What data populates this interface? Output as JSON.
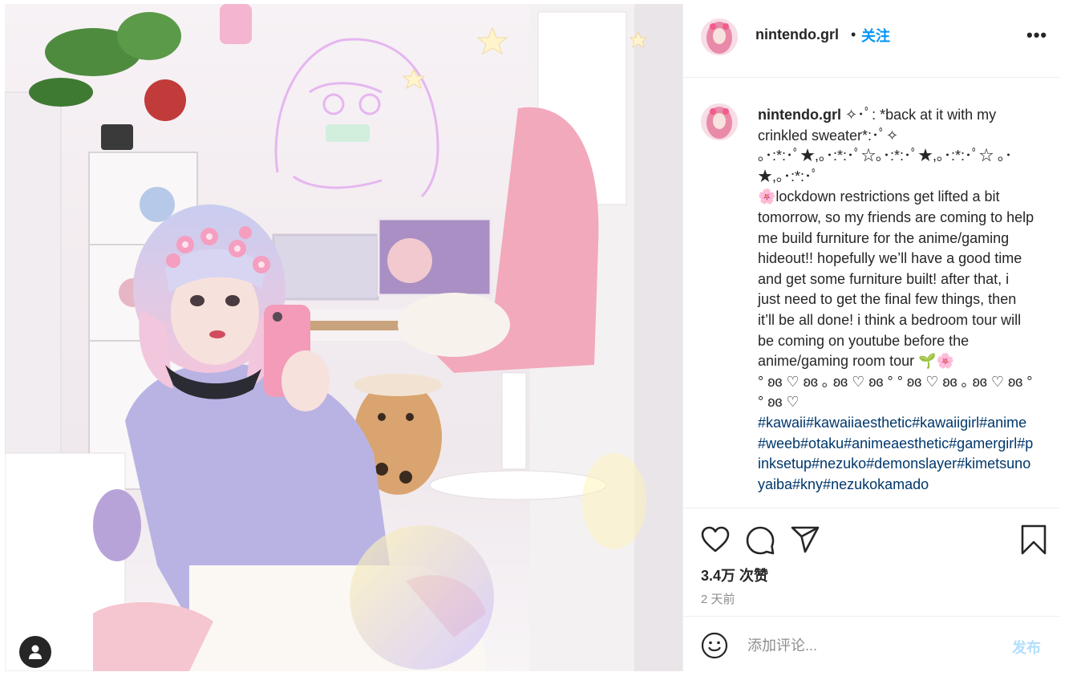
{
  "post": {
    "username": "nintendo.grl",
    "separator": "•",
    "follow_label": "关注",
    "more_icon": "more-horizontal-icon",
    "more_label": "•••"
  },
  "caption": {
    "username": "nintendo.grl",
    "text": " ✧･ﾟ: *back at it with my crinkled sweater*:･ﾟ✧\n｡･:*:･ﾟ★,｡･:*:･ﾟ☆｡･:*:･ﾟ★,｡･:*:･ﾟ☆ ｡･★,｡･:*:･ﾟ\n🌸lockdown restrictions get lifted a bit tomorrow, so my friends are coming to help me build furniture for the anime/gaming hideout!! hopefully we’ll have a good time and get some furniture built! after that, i just need to get the final few things, then it’ll be all done! i think a bedroom tour will be coming on youtube before the anime/gaming room tour 🌱🌸\n° ʚɞ ♡ ʚɞ ｡ ʚɞ ♡ ʚɞ ° ° ʚɞ ♡ ʚɞ ｡ ʚɞ ♡ ʚɞ ° ° ʚɞ ♡\n",
    "hashtags": "#kawaii#kawaiiaesthetic#kawaiigirl#anime#weeb#otaku#animeaesthetic#gamergirl#pinksetup#nezuko#demonslayer#kimetsunoyaiba#kny#nezukokamado"
  },
  "actions": {
    "like_icon": "heart-icon",
    "comment_icon": "comment-bubble-icon",
    "share_icon": "paper-plane-icon",
    "save_icon": "bookmark-icon"
  },
  "likes": "3.4万 次赞",
  "timestamp": "2 天前",
  "comment": {
    "emoji_icon": "smiley-icon",
    "placeholder": "添加评论...",
    "post_label": "发布"
  },
  "photo": {
    "tag_icon": "user-tag-icon"
  },
  "colors": {
    "link": "#0095f6",
    "hashtag": "#00376b",
    "post_disabled": "#b2dffc",
    "secondary_text": "#8e8e8e"
  }
}
